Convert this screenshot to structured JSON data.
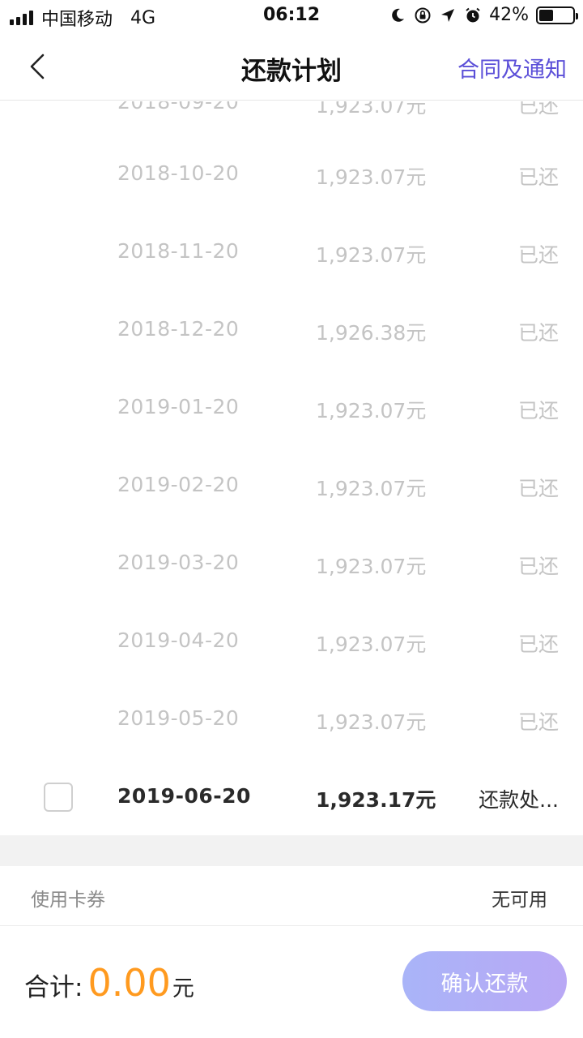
{
  "status_bar": {
    "carrier": "中国移动",
    "network": "4G",
    "time": "06:12",
    "battery": "42%",
    "battery_level": 0.42
  },
  "nav": {
    "title": "还款计划",
    "right_link": "合同及通知",
    "accent_color": "#5b4fd8"
  },
  "schedule": {
    "partial_row": {
      "date": "2018-09-20",
      "amount": "1,923.07元",
      "status": "已还"
    },
    "rows": [
      {
        "date": "2018-10-20",
        "amount": "1,923.07元",
        "status": "已还"
      },
      {
        "date": "2018-11-20",
        "amount": "1,923.07元",
        "status": "已还"
      },
      {
        "date": "2018-12-20",
        "amount": "1,926.38元",
        "status": "已还"
      },
      {
        "date": "2019-01-20",
        "amount": "1,923.07元",
        "status": "已还"
      },
      {
        "date": "2019-02-20",
        "amount": "1,923.07元",
        "status": "已还"
      },
      {
        "date": "2019-03-20",
        "amount": "1,923.07元",
        "status": "已还"
      },
      {
        "date": "2019-04-20",
        "amount": "1,923.07元",
        "status": "已还"
      },
      {
        "date": "2019-05-20",
        "amount": "1,923.07元",
        "status": "已还"
      }
    ],
    "current": {
      "date": "2019-06-20",
      "amount": "1,923.17元",
      "status": "还款处..."
    }
  },
  "coupon": {
    "label": "使用卡券",
    "value": "无可用"
  },
  "footer": {
    "total_label": "合计:",
    "total_amount": "0.00",
    "total_unit": "元",
    "total_color": "#ff9a1f",
    "confirm_label": "确认还款"
  }
}
